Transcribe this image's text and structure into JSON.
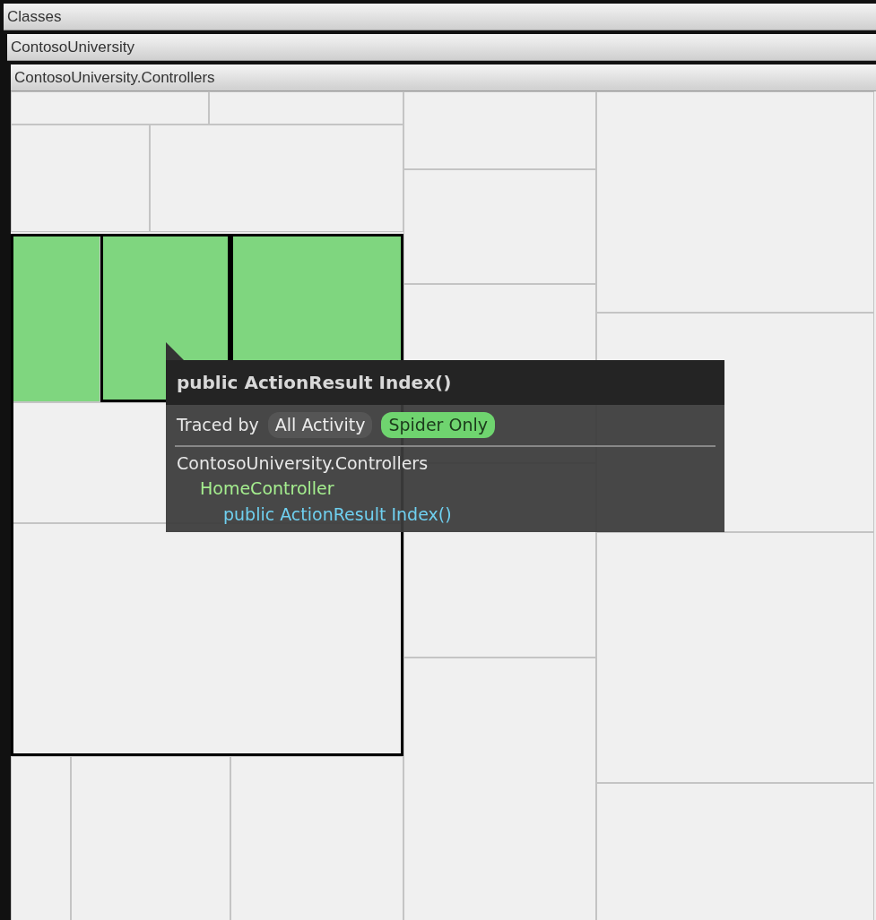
{
  "breadcrumbs": [
    {
      "label": "Classes"
    },
    {
      "label": "ContosoUniversity"
    },
    {
      "label": "ContosoUniversity.Controllers"
    }
  ],
  "treemap": {
    "cells": [
      {
        "traced": false
      },
      {
        "traced": false
      },
      {
        "traced": false
      },
      {
        "traced": false
      },
      {
        "traced": true
      },
      {
        "traced": true
      },
      {
        "traced": true
      },
      {
        "traced": false
      },
      {
        "traced": false
      },
      {
        "traced": false
      },
      {
        "traced": false
      },
      {
        "traced": false
      },
      {
        "traced": false
      },
      {
        "traced": false
      },
      {
        "traced": false
      },
      {
        "traced": false
      },
      {
        "traced": false
      },
      {
        "traced": false
      },
      {
        "traced": false
      },
      {
        "traced": false
      },
      {
        "traced": false
      }
    ]
  },
  "tooltip": {
    "title": "public ActionResult Index()",
    "traced_label": "Traced by",
    "filters": [
      {
        "label": "All Activity",
        "selected": false
      },
      {
        "label": "Spider Only",
        "selected": true
      }
    ],
    "tree": [
      {
        "label": "ContosoUniversity.Controllers",
        "children": [
          {
            "label": "HomeController",
            "children": [
              {
                "label": "public ActionResult Index()"
              }
            ]
          }
        ]
      }
    ]
  }
}
